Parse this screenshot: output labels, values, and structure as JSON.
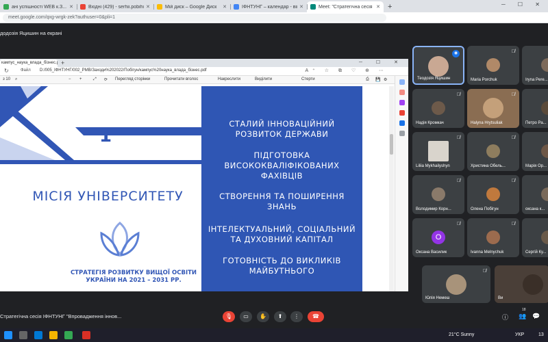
{
  "browser": {
    "tabs": [
      {
        "title": "ані успішності WEB к.З...",
        "color": "#34a853"
      },
      {
        "title": "Вхідні (429) - serhii.pobihun@n...",
        "color": "#ea4335"
      },
      {
        "title": "Мій диск – Google Диск",
        "color": "#fbbc04"
      },
      {
        "title": "ІФНТУНГ – календар - вівторок",
        "color": "#4285f4"
      },
      {
        "title": "Meet: \"Стратегічна сесія ІФ...",
        "color": "#00897b",
        "active": true
      }
    ],
    "url": "meet.google.com/qxg-wrgk-zek?authuser=0&pli=1"
  },
  "meet": {
    "presenting_label": "додозія Яцишин на екрані",
    "meeting_title": "Стратегічна сесія ІФНТУНГ \"Впровадження іннов...",
    "participant_count": "18",
    "participants": [
      {
        "name": "Теодозія Яцишин",
        "active": true
      },
      {
        "name": "Maria Porchuk"
      },
      {
        "name": "Iryna Pere..."
      },
      {
        "name": "Надія Кромкач"
      },
      {
        "name": "Halyna Hrytsuliak"
      },
      {
        "name": "Петро Ра..."
      },
      {
        "name": "Liliia Mykhailyshyn"
      },
      {
        "name": "Христина Обель..."
      },
      {
        "name": "Марія Ор..."
      },
      {
        "name": "Володимир Корн..."
      },
      {
        "name": "Олена Побігун"
      },
      {
        "name": "оксана к..."
      },
      {
        "name": "Оксана Василик",
        "initial": "О"
      },
      {
        "name": "Ivanna Melnychuk"
      },
      {
        "name": "Сергій Ку..."
      },
      {
        "name": "Юлія Немеш"
      },
      {
        "name": "Ви"
      }
    ]
  },
  "pdf": {
    "tab_title": "кампус_наука_влада_бізнес.pdf",
    "file_label": "Файл",
    "path": "D:/005_ІФНТУНГ/002_PMB/Заходи%202022/Побігун/кампус%20наука_влада_бізнес.pdf",
    "toolbar": {
      "page_info": "з 10",
      "view_page": "Перегляд сторінки",
      "read_aloud": "Прочитати вголос",
      "draw": "Накреслити",
      "highlight": "Виділити",
      "erase": "Стерти"
    }
  },
  "slide": {
    "number": "1",
    "mission": "МІСІЯ УНІВЕРСИТЕТУ",
    "strategy_line1": "СТРАТЕГІЯ РОЗВИТКУ ВИЩОЇ ОСВІТИ",
    "strategy_line2": "УКРАЇНИ НА 2021 – 2031 РР.",
    "items": [
      {
        "line1": "СТАЛИЙ ІННОВАЦІЙНИЙ",
        "line2": "РОЗВИТОК ДЕРЖАВИ"
      },
      {
        "line1": "ПІДГОТОВКА",
        "line2": "ВИСОКОКВАЛІФІКОВАНИХ",
        "line3": "ФАХІВЦІВ"
      },
      {
        "line1": "СТВОРЕННЯ ТА ПОШИРЕННЯ",
        "line2": "ЗНАНЬ"
      },
      {
        "line1": "ІНТЕЛЕКТУАЛЬНИЙ, СОЦІАЛЬНИЙ",
        "line2": "ТА ДУХОВНИЙ КАПІТАЛ"
      },
      {
        "line1": "ГОТОВНІСТЬ ДО ВИКЛИКІВ",
        "line2": "МАЙБУТНЬОГО"
      }
    ]
  },
  "taskbar": {
    "weather": "21°C  Sunny",
    "lang": "УКР",
    "time": "13"
  }
}
